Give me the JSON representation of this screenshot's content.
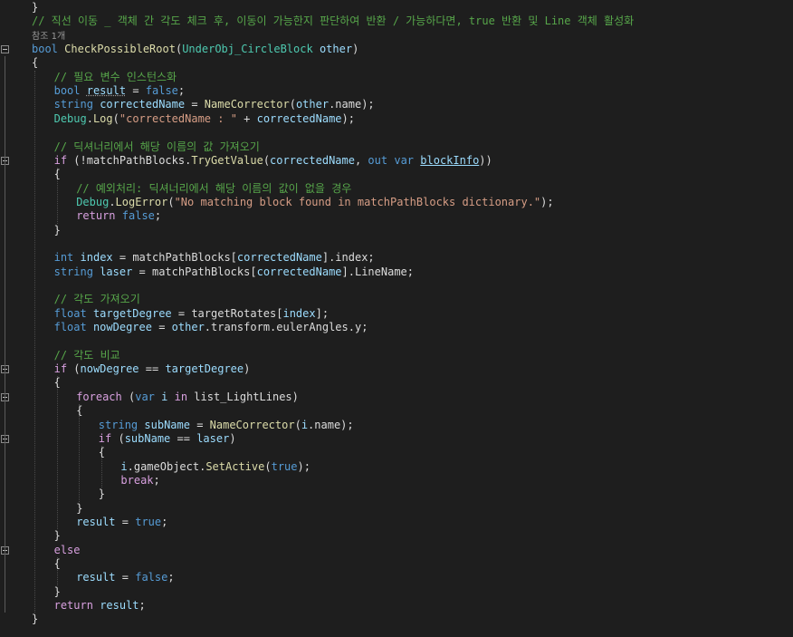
{
  "editor": {
    "theme": {
      "background": "#1e1e1e",
      "comment": "#57a64a",
      "keyword": "#569cd6",
      "control": "#d8a0df",
      "string": "#d69d85",
      "type": "#4ec9b0",
      "method": "#dcdcaa",
      "variable": "#9cdcfe"
    },
    "lines": [
      {
        "row": 0,
        "indent": 0,
        "tokens": [
          {
            "t": "}",
            "c": "plain"
          }
        ]
      },
      {
        "row": 1,
        "indent": 0,
        "tokens": [
          {
            "t": "// 직선 이동 _ 객체 간 각도 체크 후, 이동이 가능한지 판단하여 반환 / 가능하다면, true 반환 및 Line 객체 활성화",
            "c": "comment"
          }
        ]
      },
      {
        "row": 2,
        "indent": 0,
        "codelens": true,
        "tokens": [
          {
            "t": "참조 1개",
            "c": "codelens"
          }
        ]
      },
      {
        "row": 3,
        "indent": 0,
        "tokens": [
          {
            "t": "bool",
            "c": "kw"
          },
          {
            "t": " ",
            "c": "plain"
          },
          {
            "t": "CheckPossibleRoot",
            "c": "method"
          },
          {
            "t": "(",
            "c": "plain"
          },
          {
            "t": "UnderObj_CircleBlock",
            "c": "type"
          },
          {
            "t": " ",
            "c": "plain"
          },
          {
            "t": "other",
            "c": "param"
          },
          {
            "t": ")",
            "c": "plain"
          }
        ]
      },
      {
        "row": 4,
        "indent": 0,
        "tokens": [
          {
            "t": "{",
            "c": "plain"
          }
        ]
      },
      {
        "row": 5,
        "indent": 1,
        "tokens": [
          {
            "t": "// 필요 변수 인스턴스화",
            "c": "comment"
          }
        ]
      },
      {
        "row": 6,
        "indent": 1,
        "tokens": [
          {
            "t": "bool",
            "c": "kw"
          },
          {
            "t": " ",
            "c": "plain"
          },
          {
            "t": "result",
            "c": "local",
            "sq": true
          },
          {
            "t": " = ",
            "c": "plain"
          },
          {
            "t": "false",
            "c": "kw"
          },
          {
            "t": ";",
            "c": "plain"
          }
        ]
      },
      {
        "row": 7,
        "indent": 1,
        "tokens": [
          {
            "t": "string",
            "c": "kw"
          },
          {
            "t": " ",
            "c": "plain"
          },
          {
            "t": "correctedName",
            "c": "local"
          },
          {
            "t": " = ",
            "c": "plain"
          },
          {
            "t": "NameCorrector",
            "c": "method"
          },
          {
            "t": "(",
            "c": "plain"
          },
          {
            "t": "other",
            "c": "param"
          },
          {
            "t": ".name);",
            "c": "plain"
          }
        ]
      },
      {
        "row": 8,
        "indent": 1,
        "tokens": [
          {
            "t": "Debug",
            "c": "type"
          },
          {
            "t": ".",
            "c": "plain"
          },
          {
            "t": "Log",
            "c": "method"
          },
          {
            "t": "(",
            "c": "plain"
          },
          {
            "t": "\"correctedName : \"",
            "c": "str"
          },
          {
            "t": " + ",
            "c": "plain"
          },
          {
            "t": "correctedName",
            "c": "local"
          },
          {
            "t": ");",
            "c": "plain"
          }
        ]
      },
      {
        "row": 10,
        "indent": 1,
        "tokens": [
          {
            "t": "// 딕셔너리에서 해당 이름의 값 가져오기",
            "c": "comment"
          }
        ]
      },
      {
        "row": 11,
        "indent": 1,
        "tokens": [
          {
            "t": "if",
            "c": "ctl"
          },
          {
            "t": " (!matchPathBlocks.",
            "c": "plain"
          },
          {
            "t": "TryGetValue",
            "c": "method"
          },
          {
            "t": "(",
            "c": "plain"
          },
          {
            "t": "correctedName",
            "c": "local"
          },
          {
            "t": ", ",
            "c": "plain"
          },
          {
            "t": "out",
            "c": "kw"
          },
          {
            "t": " ",
            "c": "plain"
          },
          {
            "t": "var",
            "c": "kw"
          },
          {
            "t": " ",
            "c": "plain"
          },
          {
            "t": "blockInfo",
            "c": "local",
            "ul": true
          },
          {
            "t": "))",
            "c": "plain"
          }
        ]
      },
      {
        "row": 12,
        "indent": 1,
        "tokens": [
          {
            "t": "{",
            "c": "plain"
          }
        ]
      },
      {
        "row": 13,
        "indent": 2,
        "tokens": [
          {
            "t": "// 예외처리: 딕셔너리에서 해당 이름의 값이 없을 경우",
            "c": "comment"
          }
        ]
      },
      {
        "row": 14,
        "indent": 2,
        "tokens": [
          {
            "t": "Debug",
            "c": "type"
          },
          {
            "t": ".",
            "c": "plain"
          },
          {
            "t": "LogError",
            "c": "method"
          },
          {
            "t": "(",
            "c": "plain"
          },
          {
            "t": "\"No matching block found in matchPathBlocks dictionary.\"",
            "c": "str"
          },
          {
            "t": ");",
            "c": "plain"
          }
        ]
      },
      {
        "row": 15,
        "indent": 2,
        "tokens": [
          {
            "t": "return",
            "c": "ctl"
          },
          {
            "t": " ",
            "c": "plain"
          },
          {
            "t": "false",
            "c": "kw"
          },
          {
            "t": ";",
            "c": "plain"
          }
        ]
      },
      {
        "row": 16,
        "indent": 1,
        "tokens": [
          {
            "t": "}",
            "c": "plain"
          }
        ]
      },
      {
        "row": 18,
        "indent": 1,
        "tokens": [
          {
            "t": "int",
            "c": "kw"
          },
          {
            "t": " ",
            "c": "plain"
          },
          {
            "t": "index",
            "c": "local"
          },
          {
            "t": " = matchPathBlocks[",
            "c": "plain"
          },
          {
            "t": "correctedName",
            "c": "local"
          },
          {
            "t": "].index;",
            "c": "plain"
          }
        ]
      },
      {
        "row": 19,
        "indent": 1,
        "tokens": [
          {
            "t": "string",
            "c": "kw"
          },
          {
            "t": " ",
            "c": "plain"
          },
          {
            "t": "laser",
            "c": "local"
          },
          {
            "t": " = matchPathBlocks[",
            "c": "plain"
          },
          {
            "t": "correctedName",
            "c": "local"
          },
          {
            "t": "].LineName;",
            "c": "plain"
          }
        ]
      },
      {
        "row": 21,
        "indent": 1,
        "tokens": [
          {
            "t": "// 각도 가져오기",
            "c": "comment"
          }
        ]
      },
      {
        "row": 22,
        "indent": 1,
        "tokens": [
          {
            "t": "float",
            "c": "kw"
          },
          {
            "t": " ",
            "c": "plain"
          },
          {
            "t": "targetDegree",
            "c": "local"
          },
          {
            "t": " = targetRotates[",
            "c": "plain"
          },
          {
            "t": "index",
            "c": "local"
          },
          {
            "t": "];",
            "c": "plain"
          }
        ]
      },
      {
        "row": 23,
        "indent": 1,
        "tokens": [
          {
            "t": "float",
            "c": "kw"
          },
          {
            "t": " ",
            "c": "plain"
          },
          {
            "t": "nowDegree",
            "c": "local"
          },
          {
            "t": " = ",
            "c": "plain"
          },
          {
            "t": "other",
            "c": "param"
          },
          {
            "t": ".transform.eulerAngles.y;",
            "c": "plain"
          }
        ]
      },
      {
        "row": 25,
        "indent": 1,
        "tokens": [
          {
            "t": "// 각도 비교",
            "c": "comment"
          }
        ]
      },
      {
        "row": 26,
        "indent": 1,
        "tokens": [
          {
            "t": "if",
            "c": "ctl"
          },
          {
            "t": " (",
            "c": "plain"
          },
          {
            "t": "nowDegree",
            "c": "local"
          },
          {
            "t": " == ",
            "c": "plain"
          },
          {
            "t": "targetDegree",
            "c": "local"
          },
          {
            "t": ")",
            "c": "plain"
          }
        ]
      },
      {
        "row": 27,
        "indent": 1,
        "tokens": [
          {
            "t": "{",
            "c": "plain"
          }
        ]
      },
      {
        "row": 28,
        "indent": 2,
        "tokens": [
          {
            "t": "foreach",
            "c": "ctl"
          },
          {
            "t": " (",
            "c": "plain"
          },
          {
            "t": "var",
            "c": "kw"
          },
          {
            "t": " ",
            "c": "plain"
          },
          {
            "t": "i",
            "c": "local"
          },
          {
            "t": " ",
            "c": "plain"
          },
          {
            "t": "in",
            "c": "ctl"
          },
          {
            "t": " list_LightLines)",
            "c": "plain"
          }
        ]
      },
      {
        "row": 29,
        "indent": 2,
        "tokens": [
          {
            "t": "{",
            "c": "plain"
          }
        ]
      },
      {
        "row": 30,
        "indent": 3,
        "tokens": [
          {
            "t": "string",
            "c": "kw"
          },
          {
            "t": " ",
            "c": "plain"
          },
          {
            "t": "subName",
            "c": "local"
          },
          {
            "t": " = ",
            "c": "plain"
          },
          {
            "t": "NameCorrector",
            "c": "method"
          },
          {
            "t": "(",
            "c": "plain"
          },
          {
            "t": "i",
            "c": "local"
          },
          {
            "t": ".name);",
            "c": "plain"
          }
        ]
      },
      {
        "row": 31,
        "indent": 3,
        "tokens": [
          {
            "t": "if",
            "c": "ctl"
          },
          {
            "t": " (",
            "c": "plain"
          },
          {
            "t": "subName",
            "c": "local"
          },
          {
            "t": " == ",
            "c": "plain"
          },
          {
            "t": "laser",
            "c": "local"
          },
          {
            "t": ")",
            "c": "plain"
          }
        ]
      },
      {
        "row": 32,
        "indent": 3,
        "tokens": [
          {
            "t": "{",
            "c": "plain"
          }
        ]
      },
      {
        "row": 33,
        "indent": 4,
        "tokens": [
          {
            "t": "i",
            "c": "local"
          },
          {
            "t": ".gameObject.",
            "c": "plain"
          },
          {
            "t": "SetActive",
            "c": "method"
          },
          {
            "t": "(",
            "c": "plain"
          },
          {
            "t": "true",
            "c": "kw"
          },
          {
            "t": ");",
            "c": "plain"
          }
        ]
      },
      {
        "row": 34,
        "indent": 4,
        "tokens": [
          {
            "t": "break",
            "c": "ctl"
          },
          {
            "t": ";",
            "c": "plain"
          }
        ]
      },
      {
        "row": 35,
        "indent": 3,
        "tokens": [
          {
            "t": "}",
            "c": "plain"
          }
        ]
      },
      {
        "row": 36,
        "indent": 2,
        "tokens": [
          {
            "t": "}",
            "c": "plain"
          }
        ]
      },
      {
        "row": 37,
        "indent": 2,
        "tokens": [
          {
            "t": "result",
            "c": "local"
          },
          {
            "t": " = ",
            "c": "plain"
          },
          {
            "t": "true",
            "c": "kw"
          },
          {
            "t": ";",
            "c": "plain"
          }
        ]
      },
      {
        "row": 38,
        "indent": 1,
        "tokens": [
          {
            "t": "}",
            "c": "plain"
          }
        ]
      },
      {
        "row": 39,
        "indent": 1,
        "tokens": [
          {
            "t": "else",
            "c": "ctl"
          }
        ]
      },
      {
        "row": 40,
        "indent": 1,
        "tokens": [
          {
            "t": "{",
            "c": "plain"
          }
        ]
      },
      {
        "row": 41,
        "indent": 2,
        "tokens": [
          {
            "t": "result",
            "c": "local"
          },
          {
            "t": " = ",
            "c": "plain"
          },
          {
            "t": "false",
            "c": "kw"
          },
          {
            "t": ";",
            "c": "plain"
          }
        ]
      },
      {
        "row": 42,
        "indent": 1,
        "tokens": [
          {
            "t": "}",
            "c": "plain"
          }
        ]
      },
      {
        "row": 43,
        "indent": 1,
        "tokens": [
          {
            "t": "return",
            "c": "ctl"
          },
          {
            "t": " ",
            "c": "plain"
          },
          {
            "t": "result",
            "c": "local"
          },
          {
            "t": ";",
            "c": "plain"
          }
        ]
      },
      {
        "row": 44,
        "indent": 0,
        "tokens": [
          {
            "t": "}",
            "c": "plain"
          }
        ]
      }
    ]
  }
}
